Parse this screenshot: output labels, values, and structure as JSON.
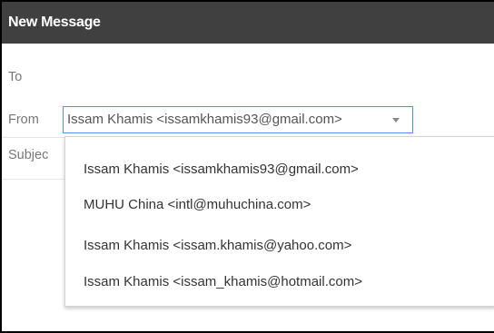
{
  "window": {
    "title": "New Message"
  },
  "fields": {
    "to_label": "To",
    "from_label": "From",
    "subject_label": "Subject"
  },
  "from_select": {
    "selected": "Issam Khamis <issamkhamis93@gmail.com>",
    "options": [
      "Issam Khamis <issamkhamis93@gmail.com>",
      "MUHU China <intl@muhuchina.com>",
      "Issam Khamis <issam.khamis@yahoo.com>",
      "Issam Khamis <issam_khamis@hotmail.com>"
    ]
  },
  "icons": {
    "dropdown_arrow": "chevron-down-icon"
  },
  "colors": {
    "titlebar_bg": "#404040",
    "titlebar_text": "#ffffff",
    "select_focus_border": "#4d90fe",
    "label_text": "#777777"
  }
}
